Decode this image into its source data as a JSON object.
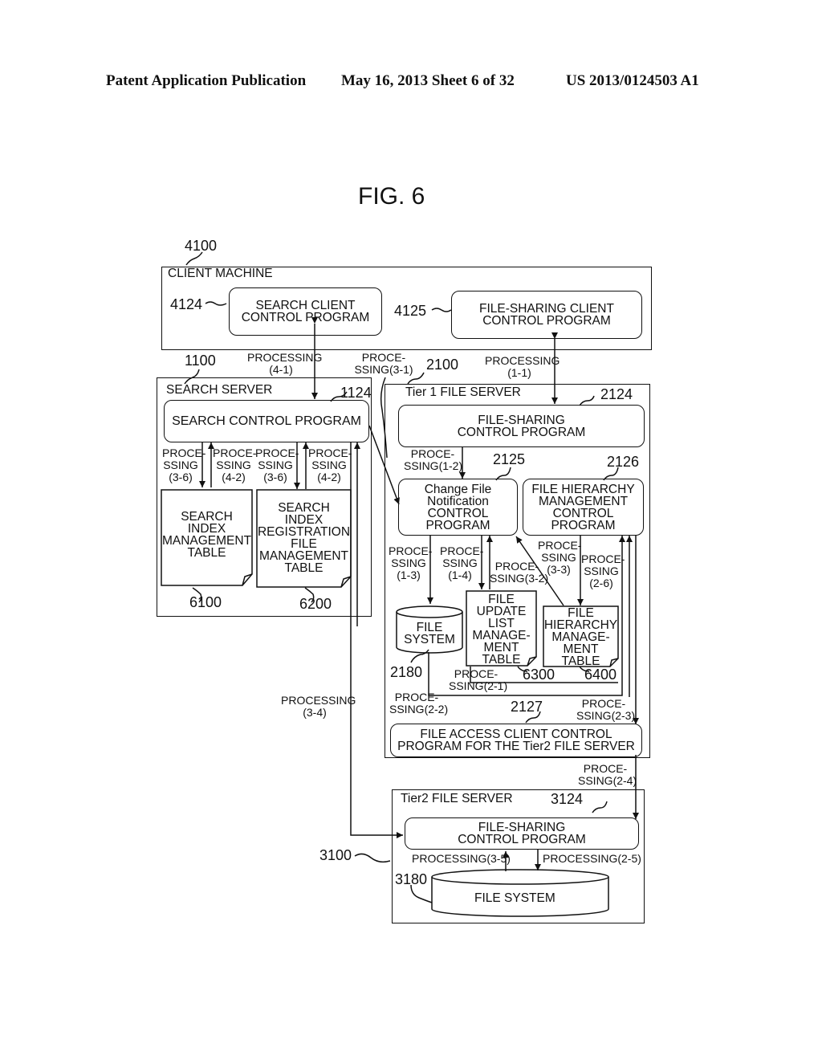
{
  "header": {
    "publication": "Patent Application Publication",
    "date_sheet": "May 16, 2013  Sheet 6 of 32",
    "patent_number": "US 2013/0124503 A1"
  },
  "figure": {
    "title": "FIG. 6"
  },
  "client_machine": {
    "ref": "4100",
    "label": "CLIENT MACHINE",
    "search_client": {
      "ref": "4124",
      "line1": "SEARCH CLIENT",
      "line2": "CONTROL PROGRAM"
    },
    "file_sharing_client": {
      "ref": "4125",
      "line1": "FILE-SHARING CLIENT",
      "line2": "CONTROL PROGRAM"
    }
  },
  "search_server": {
    "ref": "1100",
    "label": "SEARCH SERVER",
    "search_control": {
      "ref": "1124",
      "label": "SEARCH CONTROL PROGRAM"
    },
    "index_table": {
      "ref": "6100",
      "lines": [
        "SEARCH",
        "INDEX",
        "MANAGEMENT",
        "TABLE"
      ]
    },
    "registration_table": {
      "ref": "6200",
      "lines": [
        "SEARCH",
        "INDEX",
        "REGISTRATION",
        "FILE",
        "MANAGEMENT",
        "TABLE"
      ]
    }
  },
  "tier1": {
    "ref": "2100",
    "label": "Tier 1 FILE SERVER",
    "file_sharing": {
      "ref": "2124",
      "line1": "FILE-SHARING",
      "line2": "CONTROL PROGRAM"
    },
    "change_notify": {
      "ref": "2125",
      "lines": [
        "Change File",
        "Notification",
        "CONTROL",
        "PROGRAM"
      ]
    },
    "hierarchy_prog": {
      "ref": "2126",
      "lines": [
        "FILE HIERARCHY",
        "MANAGEMENT",
        "CONTROL",
        "PROGRAM"
      ]
    },
    "file_system": {
      "ref": "2180",
      "lines": [
        "FILE",
        "SYSTEM"
      ]
    },
    "update_table": {
      "ref": "6300",
      "lines": [
        "FILE",
        "UPDATE",
        "LIST",
        "MANAGE-",
        "MENT",
        "TABLE"
      ]
    },
    "hierarchy_table": {
      "ref": "6400",
      "lines": [
        "FILE",
        "HIERARCHY",
        "MANAGE-",
        "MENT",
        "TABLE"
      ]
    },
    "access_client": {
      "ref": "2127",
      "line1": "FILE ACCESS CLIENT CONTROL",
      "line2": "PROGRAM FOR THE Tier2 FILE SERVER"
    }
  },
  "tier2": {
    "ref": "3100",
    "label": "Tier2 FILE SERVER",
    "file_sharing": {
      "ref": "3124",
      "line1": "FILE-SHARING",
      "line2": "CONTROL PROGRAM"
    },
    "file_system": {
      "ref": "3180",
      "label": "FILE SYSTEM"
    }
  },
  "processing": {
    "p4_1": [
      "PROCESSING",
      "(4-1)"
    ],
    "p3_1": [
      "PROCE-",
      "SSING(3-1)"
    ],
    "p1_1": [
      "PROCESSING",
      "(1-1)"
    ],
    "p3_6a": [
      "PROCE-",
      "SSING",
      "(3-6)"
    ],
    "p4_2a": [
      "PROCE-",
      "SSING",
      "(4-2)"
    ],
    "p3_6b": [
      "PROCE-",
      "SSING",
      "(3-6)"
    ],
    "p4_2b": [
      "PROCE-",
      "SSING",
      "(4-2)"
    ],
    "p1_2": [
      "PROCE-",
      "SSING(1-2)"
    ],
    "p1_3": [
      "PROCE-",
      "SSING",
      "(1-3)"
    ],
    "p1_4": [
      "PROCE-",
      "SSING",
      "(1-4)"
    ],
    "p3_2": [
      "PROCE-",
      "SSING(3-2)"
    ],
    "p3_3": [
      "PROCE-",
      "SSING",
      "(3-3)"
    ],
    "p2_6": [
      "PROCE-",
      "SSING",
      "(2-6)"
    ],
    "p2_1": [
      "PROCE-",
      "SSING(2-1)"
    ],
    "p2_2": [
      "PROCE-",
      "SSING(2-2)"
    ],
    "p2_3": [
      "PROCE-",
      "SSING(2-3)"
    ],
    "p2_4": [
      "PROCE-",
      "SSING(2-4)"
    ],
    "p3_4": [
      "PROCESSING",
      "(3-4)"
    ],
    "p3_5": "PROCESSING(3-5)",
    "p2_5": "PROCESSING(2-5)"
  }
}
